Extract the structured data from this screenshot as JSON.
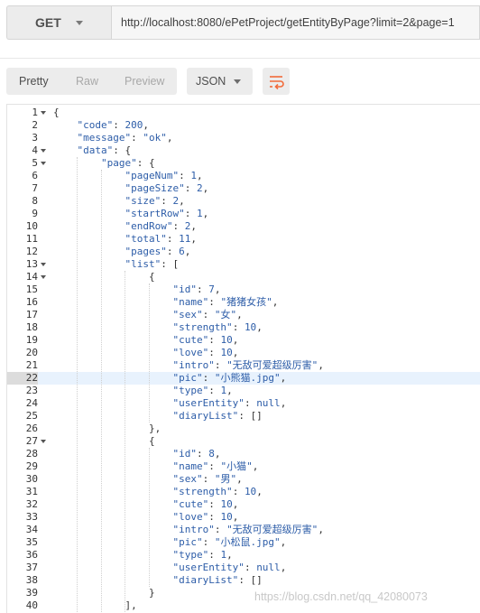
{
  "request": {
    "method": "GET",
    "url": "http://localhost:8080/ePetProject/getEntityByPage?limit=2&page=1"
  },
  "toolbar": {
    "tabs": [
      "Pretty",
      "Raw",
      "Preview"
    ],
    "active_tab": "Pretty",
    "format": "JSON",
    "wrap_icon": "wrap-lines-icon"
  },
  "editor": {
    "active_line": 22,
    "lines": [
      "{",
      "    \"code\": 200,",
      "    \"message\": \"ok\",",
      "    \"data\": {",
      "        \"page\": {",
      "            \"pageNum\": 1,",
      "            \"pageSize\": 2,",
      "            \"size\": 2,",
      "            \"startRow\": 1,",
      "            \"endRow\": 2,",
      "            \"total\": 11,",
      "            \"pages\": 6,",
      "            \"list\": [",
      "                {",
      "                    \"id\": 7,",
      "                    \"name\": \"猪猪女孩\",",
      "                    \"sex\": \"女\",",
      "                    \"strength\": 10,",
      "                    \"cute\": 10,",
      "                    \"love\": 10,",
      "                    \"intro\": \"无敌可爱超级厉害\",",
      "                    \"pic\": \"小熊猫.jpg\",",
      "                    \"type\": 1,",
      "                    \"userEntity\": null,",
      "                    \"diaryList\": []",
      "                },",
      "                {",
      "                    \"id\": 8,",
      "                    \"name\": \"小猫\",",
      "                    \"sex\": \"男\",",
      "                    \"strength\": 10,",
      "                    \"cute\": 10,",
      "                    \"love\": 10,",
      "                    \"intro\": \"无敌可爱超级厉害\",",
      "                    \"pic\": \"小松鼠.jpg\",",
      "                    \"type\": 1,",
      "                    \"userEntity\": null,",
      "                    \"diaryList\": []",
      "                }",
      "            ],"
    ],
    "foldable_lines": [
      1,
      4,
      5,
      13,
      14,
      27
    ]
  },
  "watermark": "https://blog.csdn.net/qq_42080073",
  "colors": {
    "key": "#2d5da8",
    "accent": "#f26b3a",
    "active_line": "#e8f2fd"
  }
}
